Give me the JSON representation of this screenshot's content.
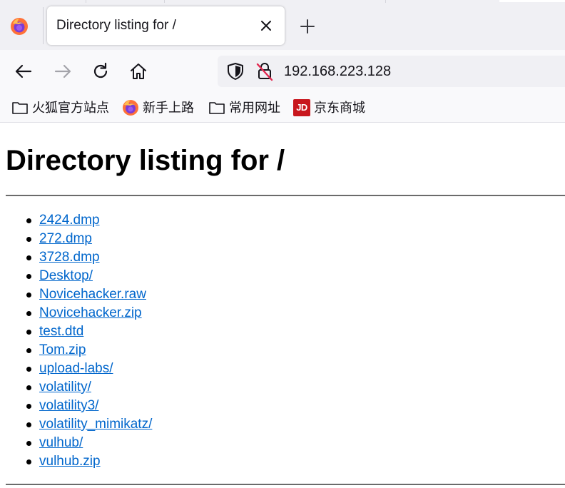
{
  "browser": {
    "tab": {
      "title": "Directory listing for /"
    },
    "url": "192.168.223.128",
    "bookmarks": [
      {
        "label": "火狐官方站点",
        "icon": "folder-icon"
      },
      {
        "label": "新手上路",
        "icon": "firefox-icon"
      },
      {
        "label": "常用网址",
        "icon": "folder-icon"
      },
      {
        "label": "京东商城",
        "icon": "jd-icon",
        "icon_text": "JD"
      }
    ],
    "colors": {
      "accent_link": "#0066cc",
      "tabstrip": "#f0f0f4",
      "toolbar": "#f9f9fb",
      "jd_red": "#c8161d"
    }
  },
  "page": {
    "title": "Directory listing for /",
    "files": [
      "2424.dmp",
      "272.dmp",
      "3728.dmp",
      "Desktop/",
      "Novicehacker.raw",
      "Novicehacker.zip",
      "test.dtd",
      "Tom.zip",
      "upload-labs/",
      "volatility/",
      "volatility3/",
      "volatility_mimikatz/",
      "vulhub/",
      "vulhub.zip"
    ]
  }
}
